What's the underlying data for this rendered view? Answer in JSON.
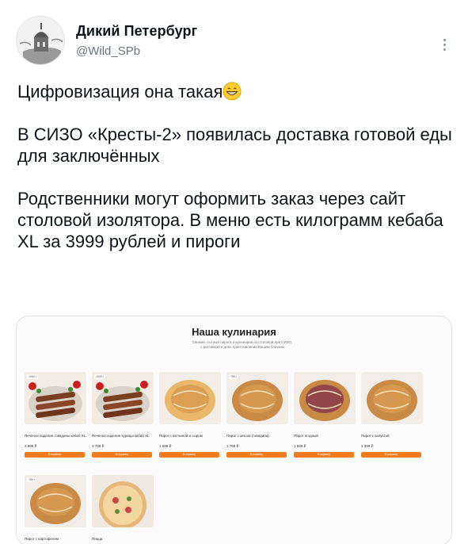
{
  "author": {
    "display_name": "Дикий Петербург",
    "handle": "@Wild_SPb"
  },
  "tweet": {
    "line1": "Цифровизация она такая",
    "line1_emoji": "grinning-face-emoji",
    "para2": "В СИЗО «Кресты-2» появилась доставка готовой еды для заключённых",
    "para3": "Родственники могут оформить заказ через сайт столовой изолятора. В меню есть килограмм кебаба XL за 3999 рублей и пироги"
  },
  "embedded_site": {
    "title": "Наша кулинария",
    "subtitle": "Свежие, сытные пироги и кулинария из столовой при СИЗО, с доставкой в день приготовления Вашим близким",
    "buy_label": "В корзину",
    "products": [
      {
        "badge": "1000 г",
        "name": "Печеное изделие говядины кебаб XL",
        "price": "3 999 ₽",
        "image": "kebab"
      },
      {
        "badge": "1000 г",
        "name": "Печеное изделие курицы кебаб XL",
        "price": "3 799 ₽",
        "image": "kebab"
      },
      {
        "badge": "",
        "name": "Пирог с ветчиной и сыром",
        "price": "1 699 ₽",
        "image": "pie-cheese"
      },
      {
        "badge": "750 г",
        "name": "Пирог с мясом (говядина)",
        "price": "1 799 ₽",
        "image": "pie-meat"
      },
      {
        "badge": "",
        "name": "Пирог ягодный",
        "price": "1 599 ₽",
        "image": "pie-berry"
      },
      {
        "badge": "",
        "name": "Пирог с капустой",
        "price": "1 399 ₽",
        "image": "pie-cabbage"
      },
      {
        "badge": "750 г",
        "name": "Пирог с картофелем",
        "price": "",
        "image": "pie-potato"
      },
      {
        "badge": "",
        "name": "Пицца",
        "price": "",
        "image": "pizza"
      }
    ]
  },
  "colors": {
    "accent": "#f07c1e",
    "text": "#0f1419",
    "muted": "#6a747c"
  }
}
